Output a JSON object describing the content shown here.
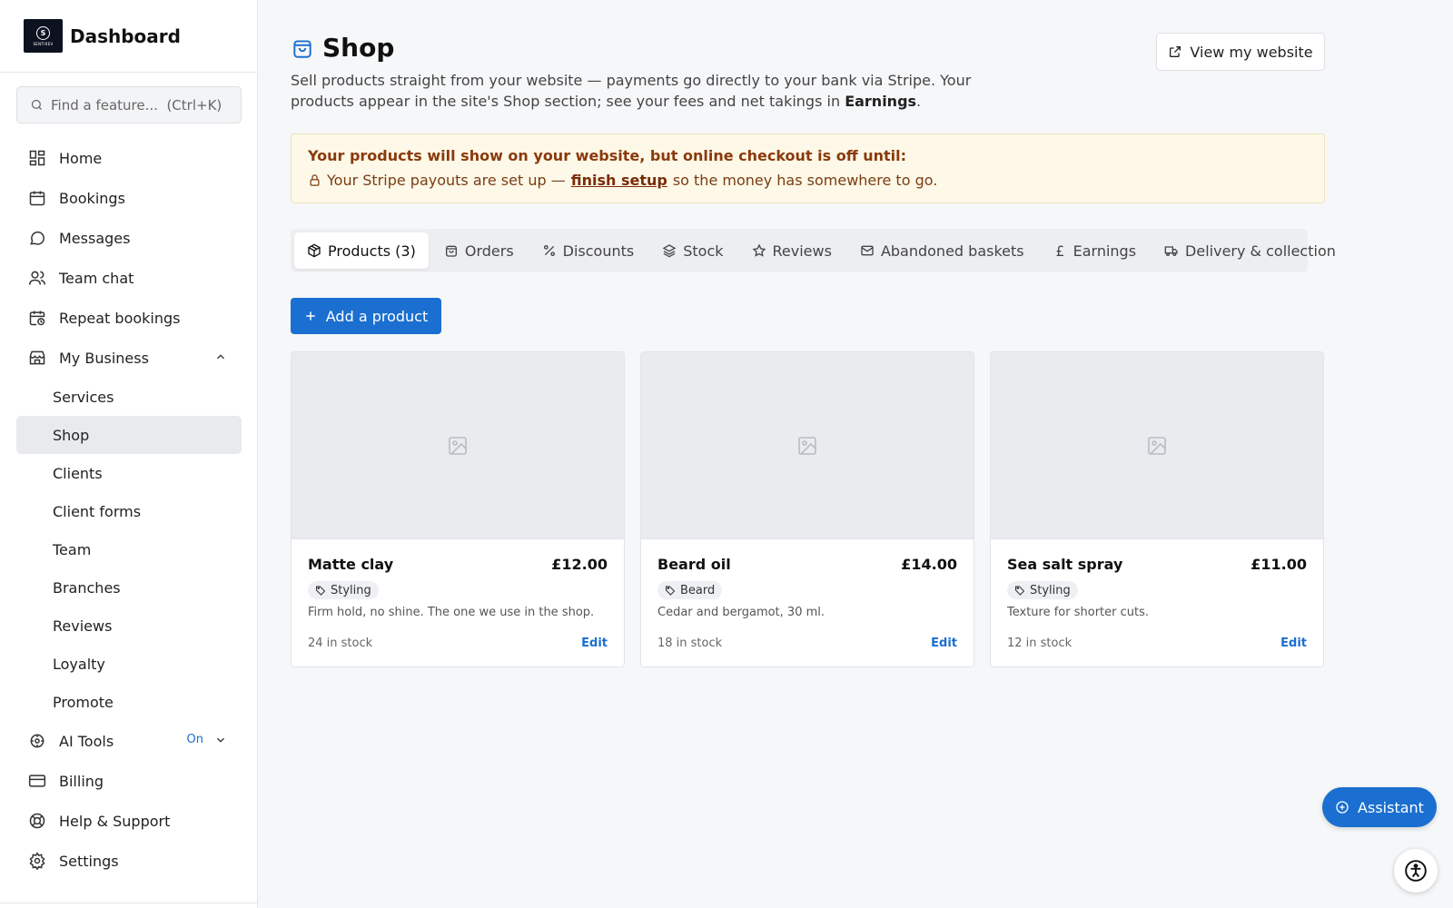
{
  "brand": {
    "title": "Dashboard",
    "logo_letter": "S",
    "logo_text": "SENTIREV"
  },
  "search": {
    "placeholder": "Find a feature...  (Ctrl+K)"
  },
  "nav": {
    "home": "Home",
    "bookings": "Bookings",
    "messages": "Messages",
    "team_chat": "Team chat",
    "repeat_bookings": "Repeat bookings",
    "my_business": "My Business",
    "sub": [
      "Services",
      "Shop",
      "Clients",
      "Client forms",
      "Team",
      "Branches",
      "Reviews",
      "Loyalty",
      "Promote"
    ],
    "ai_tools": "AI Tools",
    "ai_tools_status": "On",
    "billing": "Billing",
    "help": "Help & Support",
    "settings": "Settings"
  },
  "page": {
    "title": "Shop",
    "desc_before": "Sell products straight from your website — payments go directly to your bank via Stripe. Your products appear in the site's Shop section; see your fees and net takings in ",
    "desc_bold": "Earnings",
    "desc_after": ".",
    "view_button": "View my website"
  },
  "alert": {
    "title": "Your products will show on your website, but online checkout is off until:",
    "line_before": "Your Stripe payouts are set up —",
    "link": "finish setup",
    "line_after": "so the money has somewhere to go."
  },
  "tabs": [
    "Products (3)",
    "Orders",
    "Discounts",
    "Stock",
    "Reviews",
    "Abandoned baskets",
    "Earnings",
    "Delivery & collection"
  ],
  "add_button": "Add a product",
  "products": [
    {
      "name": "Matte clay",
      "price": "£12.00",
      "tag": "Styling",
      "desc": "Firm hold, no shine. The one we use in the shop.",
      "stock": "24 in stock",
      "edit": "Edit"
    },
    {
      "name": "Beard oil",
      "price": "£14.00",
      "tag": "Beard",
      "desc": "Cedar and bergamot, 30 ml.",
      "stock": "18 in stock",
      "edit": "Edit"
    },
    {
      "name": "Sea salt spray",
      "price": "£11.00",
      "tag": "Styling",
      "desc": "Texture for shorter cuts.",
      "stock": "12 in stock",
      "edit": "Edit"
    }
  ],
  "assistant": "Assistant",
  "colors": {
    "accent": "#1a6fd0",
    "alert_bg": "#fdf8e8",
    "alert_text": "#8a3a0c"
  },
  "icons": [
    "grid-icon",
    "calendar-icon",
    "chat-bubble-icon",
    "users-icon",
    "calendar-clock-icon",
    "store-icon",
    "ai-chip-icon",
    "credit-card-icon",
    "lifebuoy-icon",
    "gear-icon",
    "shopping-bag-icon",
    "external-link-icon",
    "lock-icon",
    "package-icon",
    "percent-icon",
    "layers-icon",
    "star-icon",
    "mail-icon",
    "pound-icon",
    "truck-icon",
    "plus-icon",
    "image-icon",
    "tag-icon",
    "accessibility-icon"
  ]
}
